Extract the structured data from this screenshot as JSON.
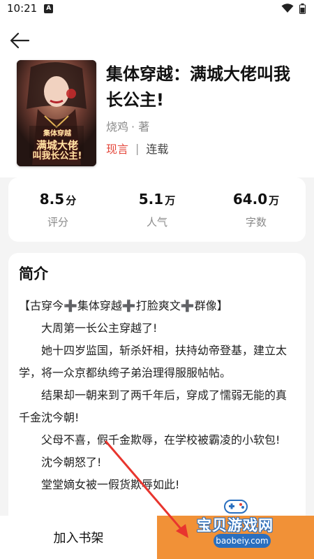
{
  "status_bar": {
    "time": "10:21",
    "notification_icon": "a-icon",
    "wifi_icon": "wifi-icon",
    "battery_icon": "battery-icon"
  },
  "header": {
    "back_icon": "arrow-left-icon"
  },
  "book": {
    "title": "集体穿越：满城大佬叫我长公主!",
    "author": "烧鸡",
    "author_suffix": "· 著",
    "genre": "现言",
    "separator": "|",
    "status": "连载",
    "cover_text": [
      "集体穿越",
      "满城大佬",
      "叫我长公主!"
    ]
  },
  "stats": [
    {
      "value": "8.5",
      "unit": "分",
      "label": "评分"
    },
    {
      "value": "5.1",
      "unit": "万",
      "label": "人气"
    },
    {
      "value": "64.0",
      "unit": "万",
      "label": "字数"
    }
  ],
  "intro": {
    "title": "简介",
    "paragraphs": [
      "【古穿今➕集体穿越➕打脸爽文➕群像】",
      "大周第一长公主穿越了!",
      "她十四岁监国，斩杀奸相，扶持幼帝登基，建立太学，将一众京都纨绔子弟治理得服服帖帖。",
      "结果却一朝来到了两千年后，穿成了懦弱无能的真千金沈今朝!",
      "父母不喜，假千金欺辱，在学校被霸凌的小软包!",
      "沈今朝怒了!",
      "堂堂嫡女被一假货欺辱如此!"
    ]
  },
  "bottom": {
    "add_shelf": "加入书架"
  },
  "watermark": {
    "title": "宝贝游戏网",
    "url": "baobeiy.com"
  },
  "colors": {
    "accent": "#f19137",
    "genre": "#e4463a",
    "watermark_blue": "#2a6fbf"
  }
}
